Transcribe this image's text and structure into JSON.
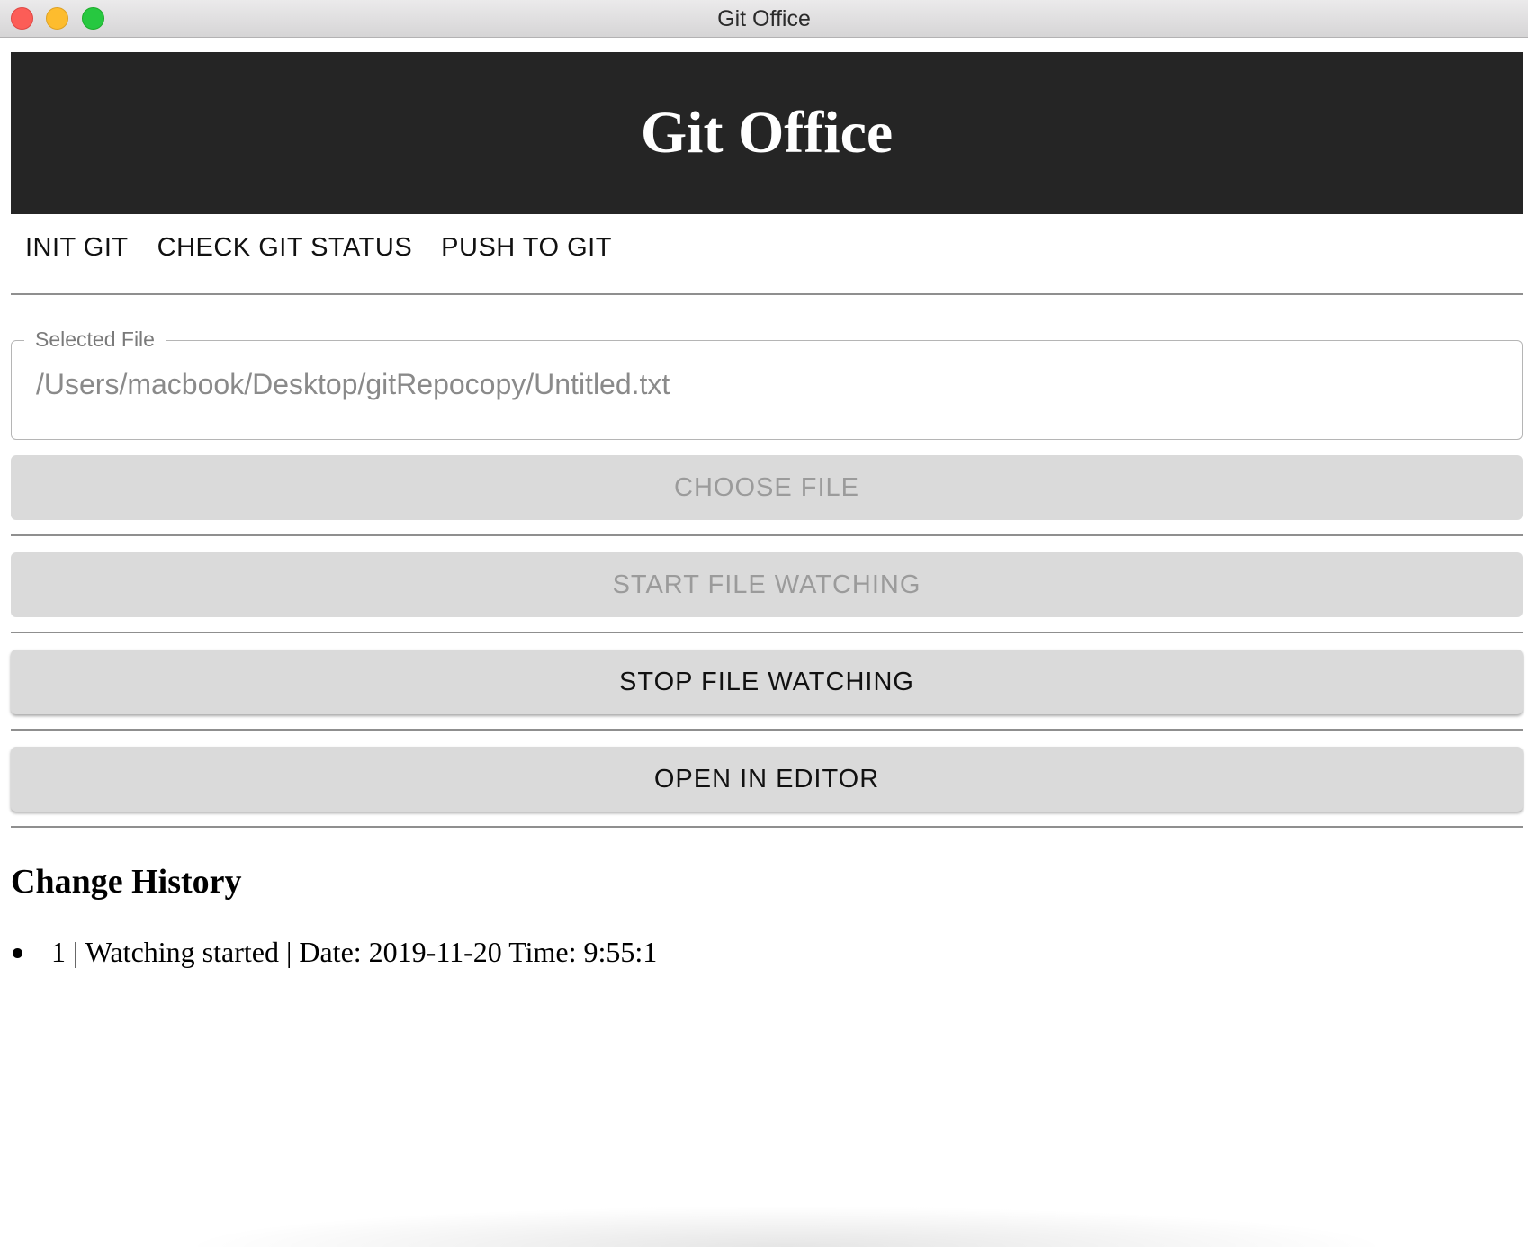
{
  "window": {
    "title": "Git Office"
  },
  "header": {
    "title": "Git Office"
  },
  "menu": {
    "items": [
      "INIT GIT",
      "CHECK GIT STATUS",
      "PUSH TO GIT"
    ]
  },
  "file_field": {
    "label": "Selected File",
    "value": "/Users/macbook/Desktop/gitRepocopy/Untitled.txt"
  },
  "actions": {
    "choose_file": "CHOOSE FILE",
    "start_watching": "START FILE WATCHING",
    "stop_watching": "STOP FILE WATCHING",
    "open_editor": "OPEN IN EDITOR"
  },
  "history": {
    "title": "Change History",
    "items": [
      "1 | Watching started | Date: 2019-11-20 Time: 9:55:1"
    ]
  }
}
